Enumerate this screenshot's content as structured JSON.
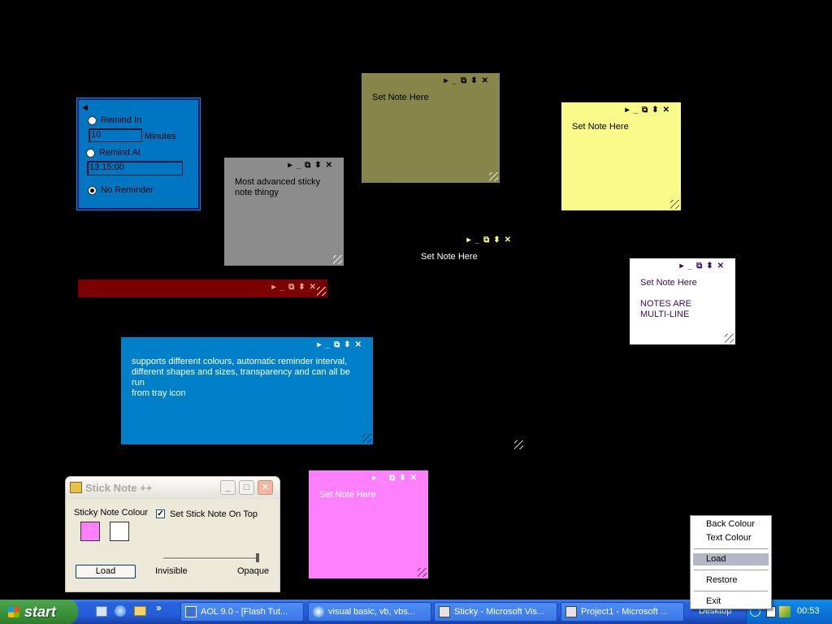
{
  "notes": {
    "olive": {
      "text": "Set Note Here",
      "color": "#86864a"
    },
    "yellow": {
      "text": "Set Note Here",
      "color": "#fafa8b"
    },
    "grey": {
      "text": "Most advanced sticky\nnote thingy",
      "color": "#8c8c8c"
    },
    "transparent": {
      "text": "Set Note Here"
    },
    "white": {
      "text": "Set Note Here\n\nNOTES ARE\nMULTI-LINE",
      "color": "#ffffff"
    },
    "darkred": {
      "color": "#7a0000"
    },
    "blue": {
      "text": "supports different colours, automatic reminder interval,\ndifferent shapes and sizes, transparency and can all be run\nfrom tray icon",
      "color": "#0080c8"
    },
    "pink": {
      "text": "Set Note Here",
      "color": "#ff80ff"
    }
  },
  "reminder": {
    "remind_in_label": "Remind In",
    "minutes_value": "10",
    "minutes_label": "Minutes",
    "remind_at_label": "Remind At",
    "time_value": "13:15:00",
    "no_reminder_label": "No Reminder"
  },
  "app_window": {
    "title": "Stick Note ++",
    "colour_label": "Sticky Note Colour",
    "on_top_label": "Set Stick Note On Top",
    "on_top_checked": "✓",
    "swatch_back": "#ff80ff",
    "swatch_text": "#ffffff",
    "load_label": "Load",
    "invisible_label": "Invisible",
    "opaque_label": "Opaque",
    "min_glyph": "_",
    "max_glyph": "□",
    "close_glyph": "✕"
  },
  "note_glyphs": {
    "arrow": "▸",
    "min": "_",
    "restore": "⧉",
    "resize": "⬍",
    "close": "✕"
  },
  "context_menu": {
    "items": [
      "Back Colour",
      "Text Colour",
      "Load",
      "Restore",
      "Exit"
    ]
  },
  "taskbar": {
    "start_label": "start",
    "more_glyph": "»",
    "tasks": [
      "AOL 9.0 - [Flash Tut...",
      "visual basic, vb, vbs...",
      "Sticky - Microsoft Vis...",
      "Project1 - Microsoft ..."
    ],
    "desktop_label": "Desktop",
    "clock": "00:53"
  }
}
